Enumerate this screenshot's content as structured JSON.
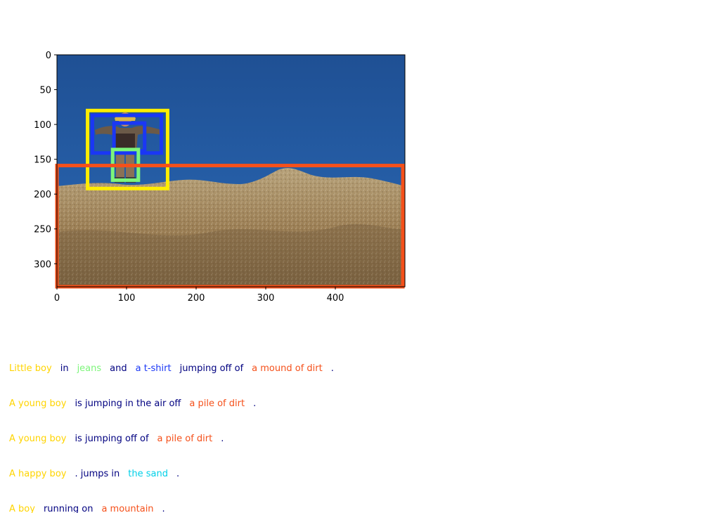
{
  "figure": {
    "image_width": 500,
    "image_height": 333,
    "y_ticks": [
      "0",
      "50",
      "100",
      "150",
      "200",
      "250",
      "300"
    ],
    "x_ticks": [
      "0",
      "100",
      "200",
      "300",
      "400"
    ],
    "boxes": [
      {
        "label": "boy",
        "color": "#ffee00",
        "x1": 44,
        "y1": 80,
        "x2": 159,
        "y2": 192
      },
      {
        "label": "t-shirt",
        "color": "#1a37f5",
        "x1": 51,
        "y1": 87,
        "x2": 150,
        "y2": 141
      },
      {
        "label": "t-shirt-inner",
        "color": "#1a37f5",
        "x1": 82,
        "y1": 98,
        "x2": 126,
        "y2": 138
      },
      {
        "label": "jeans",
        "color": "#7df57a",
        "x1": 80,
        "y1": 136,
        "x2": 117,
        "y2": 180
      },
      {
        "label": "dirt",
        "color": "#f5501a",
        "x1": 0,
        "y1": 159,
        "x2": 497,
        "y2": 333
      }
    ]
  },
  "colors": {
    "yellow": "#ffd400",
    "navy": "#000080",
    "green": "#7df57a",
    "blue": "#1a37f5",
    "orange": "#f5501a",
    "cyan": "#00d0e8"
  },
  "captions": [
    [
      {
        "text": "Little boy",
        "color": "#ffd400"
      },
      {
        "text": "in",
        "color": "#000080"
      },
      {
        "text": "jeans",
        "color": "#7df57a"
      },
      {
        "text": "and",
        "color": "#000080"
      },
      {
        "text": "a t-shirt",
        "color": "#1a37f5"
      },
      {
        "text": "jumping off of",
        "color": "#000080"
      },
      {
        "text": "a mound of dirt",
        "color": "#f5501a"
      },
      {
        "text": ".",
        "color": "#000080"
      }
    ],
    [
      {
        "text": "A young boy",
        "color": "#ffd400"
      },
      {
        "text": "is jumping in the air off",
        "color": "#000080"
      },
      {
        "text": "a pile of dirt",
        "color": "#f5501a"
      },
      {
        "text": ".",
        "color": "#000080"
      }
    ],
    [
      {
        "text": "A young boy",
        "color": "#ffd400"
      },
      {
        "text": "is jumping off of",
        "color": "#000080"
      },
      {
        "text": "a pile of dirt",
        "color": "#f5501a"
      },
      {
        "text": ".",
        "color": "#000080"
      }
    ],
    [
      {
        "text": "A happy boy",
        "color": "#ffd400"
      },
      {
        "text": ". jumps in",
        "color": "#000080"
      },
      {
        "text": "the sand",
        "color": "#00d0e8"
      },
      {
        "text": ".",
        "color": "#000080"
      }
    ],
    [
      {
        "text": "A boy",
        "color": "#ffd400"
      },
      {
        "text": "running on",
        "color": "#000080"
      },
      {
        "text": "a mountain",
        "color": "#f5501a"
      },
      {
        "text": ".",
        "color": "#000080"
      }
    ]
  ]
}
